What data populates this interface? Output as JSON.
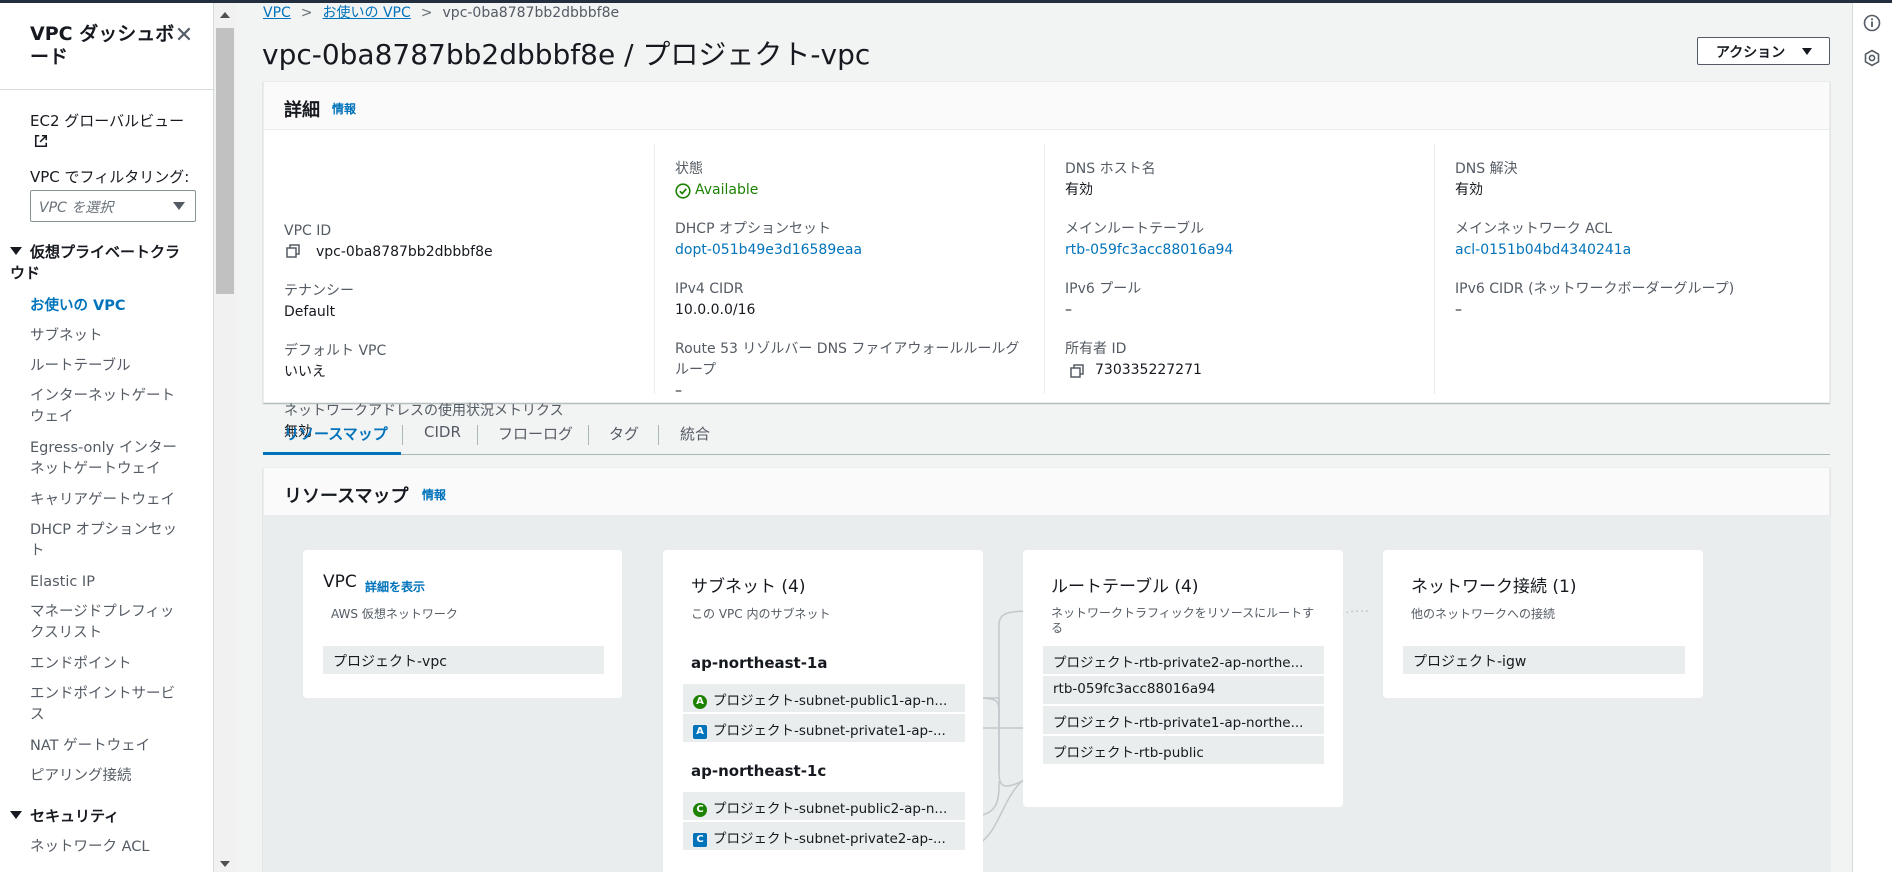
{
  "sidebar": {
    "title": "VPC ダッシュボード",
    "close_icon": "close-icon",
    "ec2_global_view": "EC2 グローバルビュー",
    "filter_label": "VPC でフィルタリング:",
    "filter_placeholder": "VPC を選択",
    "section_vpc": "仮想プライベートクラウド",
    "items": [
      {
        "label": "お使いの VPC",
        "active": true
      },
      {
        "label": "サブネット"
      },
      {
        "label": "ルートテーブル"
      },
      {
        "label": "インターネットゲートウェイ"
      },
      {
        "label": "Egress-only インターネットゲートウェイ"
      },
      {
        "label": "キャリアゲートウェイ"
      },
      {
        "label": "DHCP オプションセット"
      },
      {
        "label": "Elastic IP"
      },
      {
        "label": "マネージドプレフィックスリスト"
      },
      {
        "label": "エンドポイント"
      },
      {
        "label": "エンドポイントサービス"
      },
      {
        "label": "NAT ゲートウェイ"
      },
      {
        "label": "ピアリング接続"
      }
    ],
    "section_security": "セキュリティ",
    "security_items": [
      {
        "label": "ネットワーク ACL"
      }
    ]
  },
  "breadcrumb": {
    "items": [
      "VPC",
      "お使いの VPC"
    ],
    "current": "vpc-0ba8787bb2dbbbf8e"
  },
  "page": {
    "title": "vpc-0ba8787bb2dbbbf8e / プロジェクト-vpc",
    "action_label": "アクション"
  },
  "details": {
    "title": "詳細",
    "info": "情報",
    "columns": [
      [
        {
          "label": "VPC ID",
          "value": "vpc-0ba8787bb2dbbbf8e",
          "copy": true
        },
        {
          "label": "テナンシー",
          "value": "Default"
        },
        {
          "label": "デフォルト VPC",
          "value": "いいえ"
        },
        {
          "label": "ネットワークアドレスの使用状況メトリクス",
          "value": "無効"
        }
      ],
      [
        {
          "label": "状態",
          "value": "Available",
          "status": true
        },
        {
          "label": "DHCP オプションセット",
          "value": "dopt-051b49e3d16589eaa",
          "link": true
        },
        {
          "label": "IPv4 CIDR",
          "value": "10.0.0.0/16"
        },
        {
          "label": "Route 53 リゾルバー DNS ファイアウォールルールグループ",
          "value": "–"
        }
      ],
      [
        {
          "label": "DNS ホスト名",
          "value": "有効"
        },
        {
          "label": "メインルートテーブル",
          "value": "rtb-059fc3acc88016a94",
          "link": true
        },
        {
          "label": "IPv6 プール",
          "value": "–"
        },
        {
          "label": "所有者 ID",
          "value": "730335227271",
          "copy": true
        }
      ],
      [
        {
          "label": "DNS 解決",
          "value": "有効"
        },
        {
          "label": "メインネットワーク ACL",
          "value": "acl-0151b04bd4340241a",
          "link": true
        },
        {
          "label": "IPv6 CIDR (ネットワークボーダーグループ)",
          "value": "–"
        }
      ]
    ]
  },
  "tabs": [
    "リソースマップ",
    "CIDR",
    "フローログ",
    "タグ",
    "統合"
  ],
  "resource_map": {
    "title": "リソースマップ",
    "info": "情報",
    "vpc_card": {
      "title": "VPC",
      "detail_link": "詳細を表示",
      "sub": "AWS 仮想ネットワーク",
      "item": "プロジェクト-vpc"
    },
    "subnet_card": {
      "title": "サブネット (4)",
      "sub": "この VPC 内のサブネット",
      "groups": [
        {
          "az": "ap-northeast-1a",
          "items": [
            {
              "badge": "A",
              "shape": "circle",
              "label": "プロジェクト-subnet-public1-ap-n..."
            },
            {
              "badge": "A",
              "shape": "square",
              "label": "プロジェクト-subnet-private1-ap-..."
            }
          ]
        },
        {
          "az": "ap-northeast-1c",
          "items": [
            {
              "badge": "C",
              "shape": "circle",
              "label": "プロジェクト-subnet-public2-ap-n..."
            },
            {
              "badge": "C",
              "shape": "square",
              "label": "プロジェクト-subnet-private2-ap-..."
            }
          ]
        }
      ]
    },
    "route_card": {
      "title": "ルートテーブル (4)",
      "sub": "ネットワークトラフィックをリソースにルートする",
      "items": [
        "プロジェクト-rtb-private2-ap-northe...",
        "rtb-059fc3acc88016a94",
        "プロジェクト-rtb-private1-ap-northe...",
        "プロジェクト-rtb-public"
      ]
    },
    "network_card": {
      "title": "ネットワーク接続 (1)",
      "sub": "他のネットワークへの接続",
      "item": "プロジェクト-igw"
    }
  },
  "colors": {
    "link": "#0073bb",
    "success": "#1d8102",
    "badge_private": "#0073bb"
  }
}
